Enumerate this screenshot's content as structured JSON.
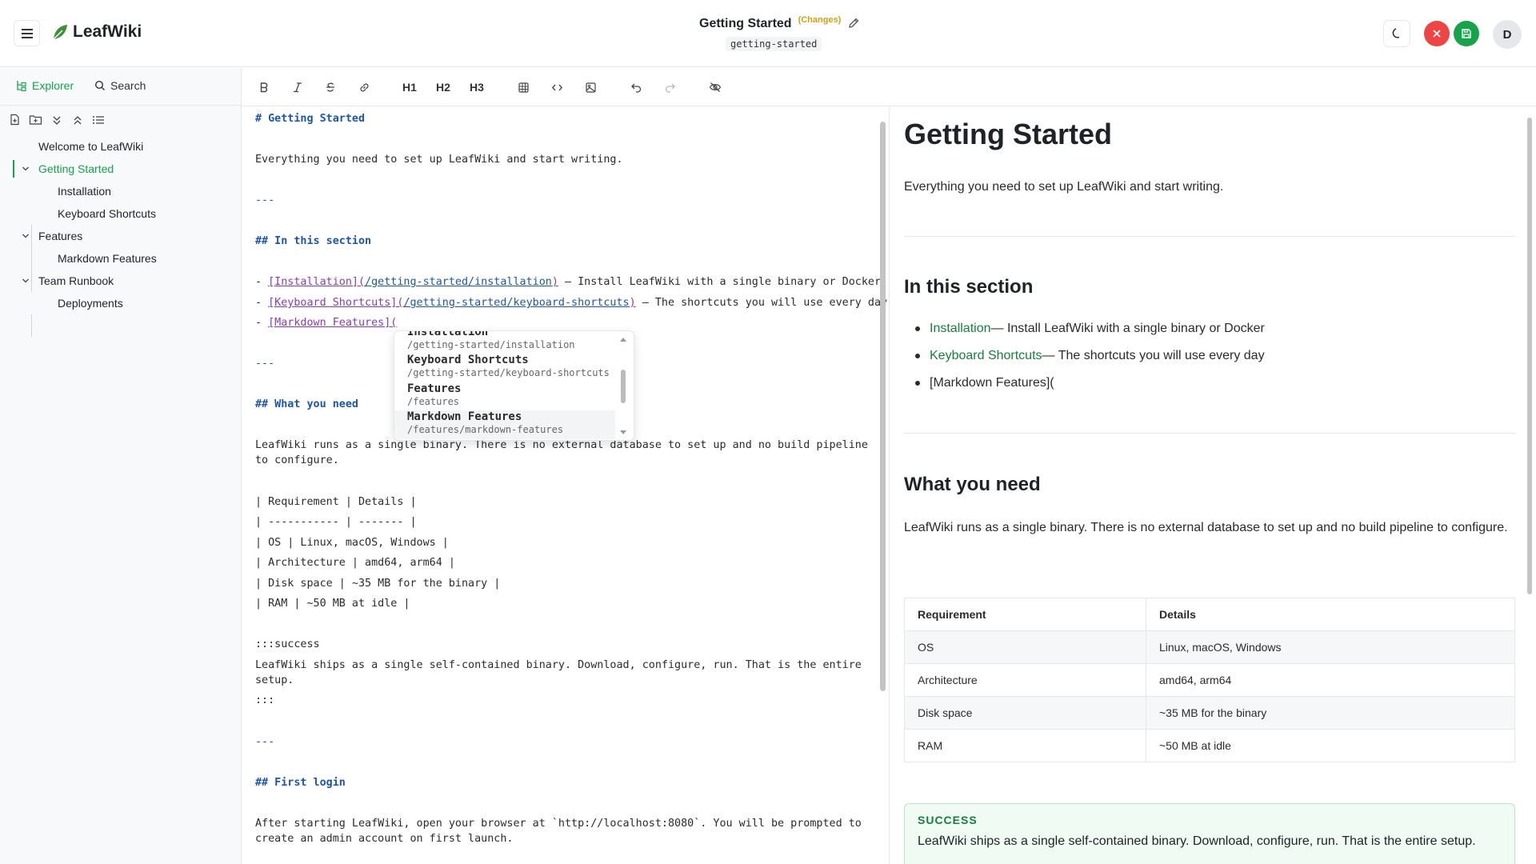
{
  "header": {
    "app_name": "LeafWiki",
    "page_title": "Getting Started",
    "changes_badge": "(Changes)",
    "slug": "getting-started",
    "avatar_initial": "D"
  },
  "sidebar": {
    "tabs": {
      "explorer": "Explorer",
      "search": "Search"
    },
    "tree": [
      {
        "label": "Welcome to LeafWiki",
        "level": 0
      },
      {
        "label": "Getting Started",
        "level": 0,
        "expanded": true,
        "active": true
      },
      {
        "label": "Installation",
        "level": 1
      },
      {
        "label": "Keyboard Shortcuts",
        "level": 1
      },
      {
        "label": "Features",
        "level": 0,
        "expanded": true
      },
      {
        "label": "Markdown Features",
        "level": 1
      },
      {
        "label": "Team Runbook",
        "level": 0,
        "expanded": true
      },
      {
        "label": "Deployments",
        "level": 1
      }
    ]
  },
  "toolbar": {
    "h1": "H1",
    "h2": "H2",
    "h3": "H3"
  },
  "editor": {
    "l1": "# Getting Started",
    "l2": "Everything you need to set up LeafWiki and start writing.",
    "l3": "---",
    "l4": "## In this section",
    "l5a": "[Installation](",
    "l5b": "/getting-started/installation",
    "l5c": ")",
    "l5d": " — Install LeafWiki with a single binary or Docker",
    "l6a": "[Keyboard Shortcuts](",
    "l6b": "/getting-started/keyboard-shortcuts",
    "l6c": ")",
    "l6d": " — The shortcuts you will use every day",
    "l7a": "[Markdown Features](",
    "l8": "---",
    "l9": "## What you need",
    "l10": "LeafWiki runs as a single binary. There is no external database to set up and no build pipeline",
    "l11": "to configure.",
    "l12": "| Requirement | Details |",
    "l13": "| ----------- | ------- |",
    "l14": "| OS | Linux, macOS, Windows |",
    "l15": "| Architecture | amd64, arm64 |",
    "l16": "| Disk space | ~35 MB for the binary |",
    "l17": "| RAM | ~50 MB at idle |",
    "l18": ":::success",
    "l19": "LeafWiki ships as a single self-contained binary. Download, configure, run. That is the entire",
    "l20": "setup.",
    "l21": ":::",
    "l22": "---",
    "l23": "## First login",
    "l24": "After starting LeafWiki, open your browser at `http://localhost:8080`. You will be prompted to",
    "l25": "create an admin account on first launch."
  },
  "autocomplete": [
    {
      "title": "Installation",
      "path": "/getting-started/installation"
    },
    {
      "title": "Keyboard Shortcuts",
      "path": "/getting-started/keyboard-shortcuts"
    },
    {
      "title": "Features",
      "path": "/features"
    },
    {
      "title": "Markdown Features",
      "path": "/features/markdown-features"
    }
  ],
  "preview": {
    "h1": "Getting Started",
    "intro": "Everything you need to set up LeafWiki and start writing.",
    "section1": "In this section",
    "items": [
      {
        "link": "Installation",
        "rest": " — Install LeafWiki with a single binary or Docker"
      },
      {
        "link": "Keyboard Shortcuts",
        "rest": " — The shortcuts you will use every day"
      },
      {
        "link": "",
        "rest": "[Markdown Features]("
      }
    ],
    "section2": "What you need",
    "need_text": "LeafWiki runs as a single binary. There is no external database to set up and no build pipeline to configure.",
    "table": {
      "headers": [
        "Requirement",
        "Details"
      ],
      "rows": [
        [
          "OS",
          "Linux, macOS, Windows"
        ],
        [
          "Architecture",
          "amd64, arm64"
        ],
        [
          "Disk space",
          "~35 MB for the binary"
        ],
        [
          "RAM",
          "~50 MB at idle"
        ]
      ]
    },
    "success_title": "SUCCESS",
    "success_body": "LeafWiki ships as a single self-contained binary. Download, configure, run. That is the entire setup."
  },
  "colors": {
    "accent": "#16a34a",
    "danger": "#ef4444",
    "changes": "#d4a017",
    "md_heading": "#1d56a8",
    "md_link": "#8a3ab9"
  }
}
